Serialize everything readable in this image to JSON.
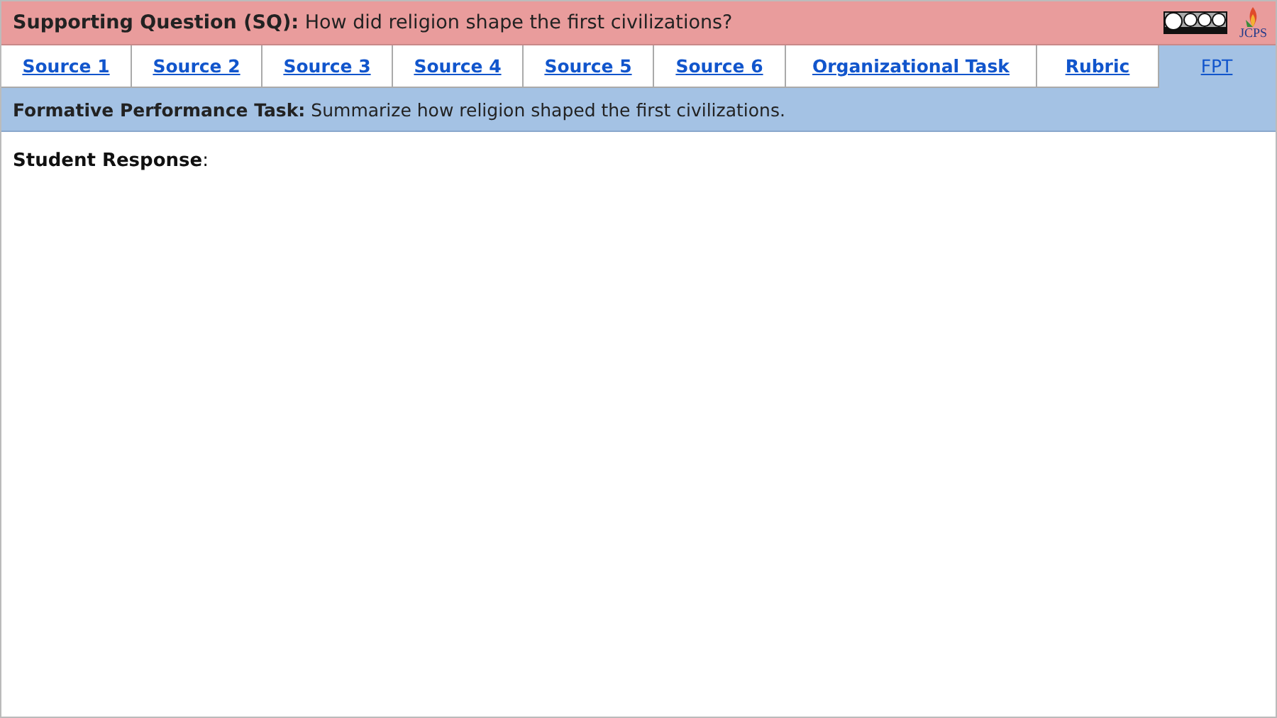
{
  "header": {
    "label": "Supporting Question (SQ):",
    "question": "How did religion shape the first civilizations?",
    "logo_text": "JCPS"
  },
  "tabs": [
    {
      "label": "Source 1",
      "selected": false
    },
    {
      "label": "Source 2",
      "selected": false
    },
    {
      "label": "Source 3",
      "selected": false
    },
    {
      "label": "Source 4",
      "selected": false
    },
    {
      "label": "Source 5",
      "selected": false
    },
    {
      "label": "Source 6",
      "selected": false
    },
    {
      "label": "Organizational Task",
      "selected": false
    },
    {
      "label": "Rubric",
      "selected": false
    },
    {
      "label": "FPT",
      "selected": true
    }
  ],
  "task": {
    "label": "Formative Performance Task:",
    "text": "Summarize how religion shaped the first civilizations."
  },
  "response": {
    "label": "Student Response",
    "suffix": ":"
  }
}
